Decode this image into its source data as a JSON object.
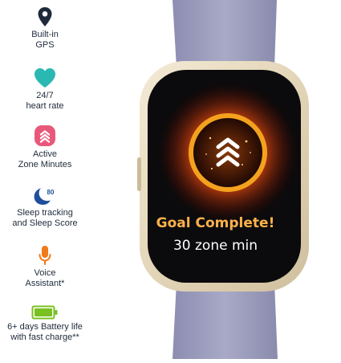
{
  "features": [
    {
      "icon": "location-pin-icon",
      "label": "Built-in\nGPS",
      "color": "#1e2a3a"
    },
    {
      "icon": "heart-icon",
      "label": "24/7\nheart rate",
      "color": "#2ab8b2"
    },
    {
      "icon": "active-zone-icon",
      "label": "Active\nZone Minutes",
      "color": "#e8587a"
    },
    {
      "icon": "sleep-moon-icon",
      "label": "Sleep tracking\nand Sleep Score",
      "color": "#1f4f9c",
      "badge": "80"
    },
    {
      "icon": "microphone-icon",
      "label": "Voice\nAssistant*",
      "color": "#f07a1a"
    },
    {
      "icon": "battery-icon",
      "label": "6+ days Battery life\nwith fast charge**",
      "color": "#79c021"
    }
  ],
  "watch": {
    "goal_text": "Goal Complete!",
    "zone_text": "30 zone min",
    "band_color": "#9a9bbc",
    "case_color": "#e8dcc3",
    "glow_color": "#ff7a1a",
    "ring_color": "#f4a21e"
  }
}
